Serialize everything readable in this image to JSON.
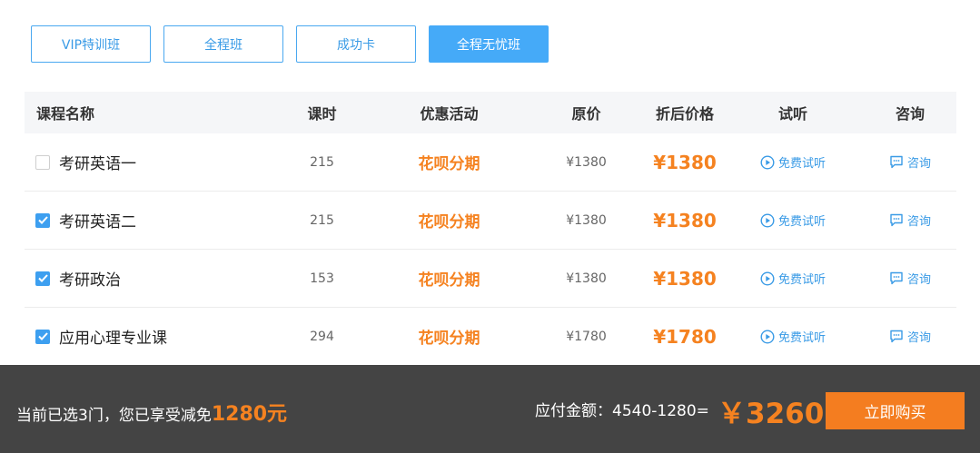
{
  "tabs": [
    {
      "label": "VIP特训班",
      "active": false
    },
    {
      "label": "全程班",
      "active": false
    },
    {
      "label": "成功卡",
      "active": false
    },
    {
      "label": "全程无忧班",
      "active": true
    }
  ],
  "table": {
    "headers": {
      "name": "课程名称",
      "hours": "课时",
      "promo": "优惠活动",
      "original": "原价",
      "discounted": "折后价格",
      "trial": "试听",
      "consult": "咨询"
    },
    "rows": [
      {
        "checked": false,
        "name": "考研英语一",
        "hours": "215",
        "promo": "花呗分期",
        "original": "¥1380",
        "price": "¥1380",
        "trial": "免费试听",
        "consult": "咨询"
      },
      {
        "checked": true,
        "name": "考研英语二",
        "hours": "215",
        "promo": "花呗分期",
        "original": "¥1380",
        "price": "¥1380",
        "trial": "免费试听",
        "consult": "咨询"
      },
      {
        "checked": true,
        "name": "考研政治",
        "hours": "153",
        "promo": "花呗分期",
        "original": "¥1380",
        "price": "¥1380",
        "trial": "免费试听",
        "consult": "咨询"
      },
      {
        "checked": true,
        "name": "应用心理专业课",
        "hours": "294",
        "promo": "花呗分期",
        "original": "¥1780",
        "price": "¥1780",
        "trial": "免费试听",
        "consult": "咨询"
      }
    ]
  },
  "footer": {
    "summary_prefix": "当前已选3门，您已享受减免",
    "saved_amount": "1280元",
    "payable_label": "应付金额：4540-1280=",
    "total": "￥3260",
    "buy_label": "立即购买"
  },
  "colors": {
    "accent_blue": "#45aaf8",
    "accent_orange": "#f58220",
    "footer_bg": "#444444"
  },
  "icons": {
    "trial": "play-circle-icon",
    "consult": "chat-bubble-icon",
    "checkbox": "checkmark-icon"
  }
}
